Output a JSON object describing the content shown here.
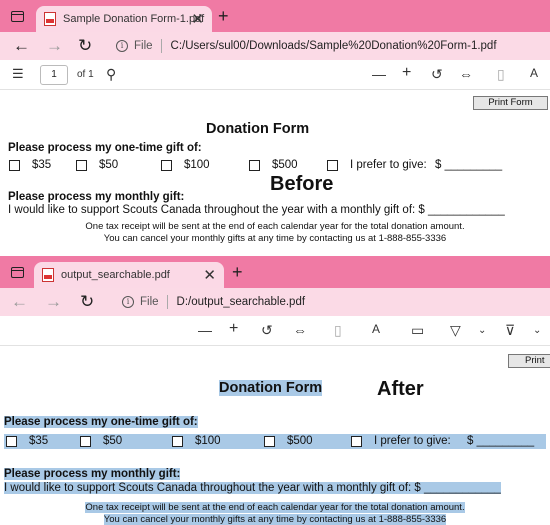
{
  "before": {
    "tab_title": "Sample Donation Form-1.pdf",
    "file_label": "File",
    "url": "C:/Users/sul00/Downloads/Sample%20Donation%20Form-1.pdf",
    "page_number": "1",
    "page_of": "of 1",
    "overlay_label": "Before"
  },
  "after": {
    "tab_title": "output_searchable.pdf",
    "file_label": "File",
    "url": "D:/output_searchable.pdf",
    "overlay_label": "After"
  },
  "form": {
    "print_button": "Print Form",
    "print_button_cut": "Print",
    "title": "Donation Form",
    "one_time_heading": "Please process my one-time gift of:",
    "options": [
      "$35",
      "$50",
      "$100",
      "$500",
      "I prefer to give:"
    ],
    "prefer_blank": "$ _________",
    "monthly_heading": "Please process my monthly gift:",
    "monthly_line": "I would like to support Scouts Canada throughout the year with a monthly gift of: $ ____________",
    "note_line1": "One tax receipt will be sent at the end of each calendar year for the total donation amount.",
    "note_line2": "You can cancel your monthly gifts at any time by contacting us at 1-888-855-3336"
  },
  "icons": {
    "tab_pdf": "pdf-file-icon",
    "close": "close-icon",
    "new_tab": "plus-icon",
    "back": "arrow-left-icon",
    "forward": "arrow-right-icon",
    "refresh": "refresh-icon",
    "info": "info-icon"
  },
  "colors": {
    "tabbar": "#f07aa4",
    "addressbar": "#fbdae6",
    "selection_highlight": "#a9c9e6"
  }
}
